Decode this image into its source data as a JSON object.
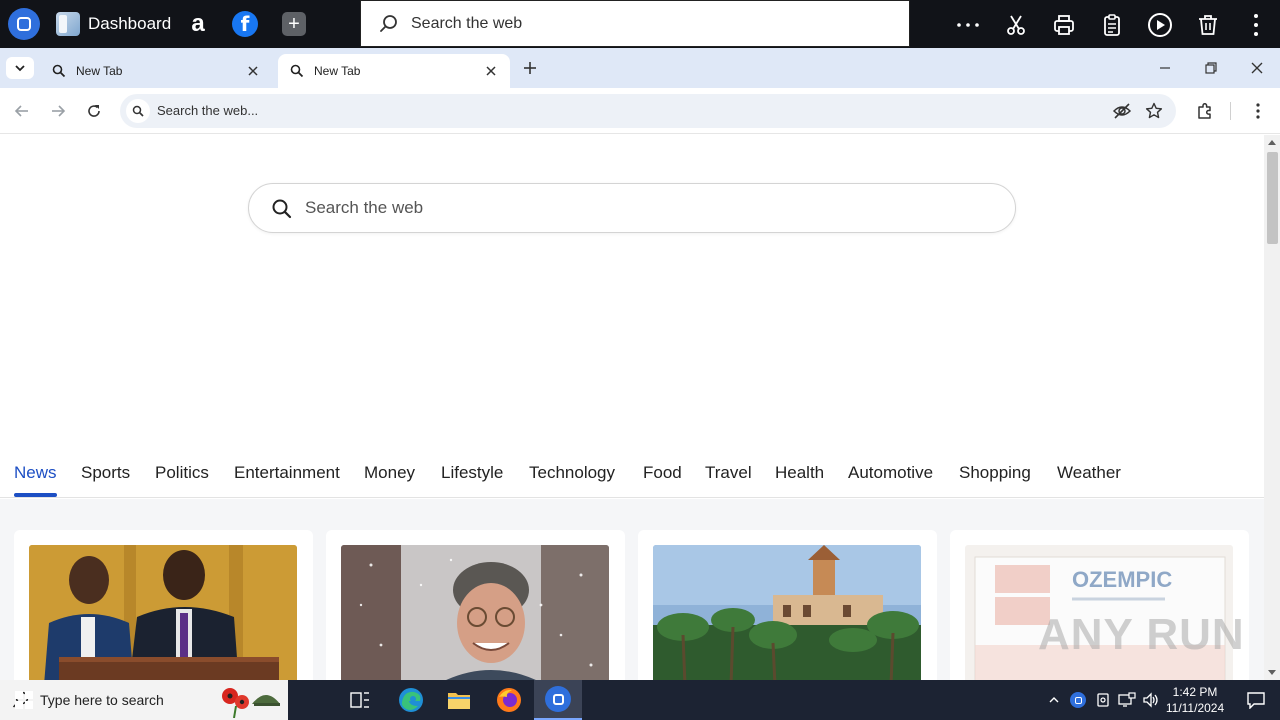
{
  "appbar": {
    "dashboard_label": "Dashboard",
    "search_placeholder": "Search the web",
    "amazon_glyph": "a",
    "facebook_glyph": "f",
    "plus_glyph": "+"
  },
  "tabs": [
    {
      "title": "New Tab",
      "active": false
    },
    {
      "title": "New Tab",
      "active": true
    }
  ],
  "toolbar": {
    "omnibox_placeholder": "Search the web..."
  },
  "page": {
    "search_placeholder": "Search the web",
    "categories": [
      "News",
      "Sports",
      "Politics",
      "Entertainment",
      "Money",
      "Lifestyle",
      "Technology",
      "Food",
      "Travel",
      "Health",
      "Automotive",
      "Shopping",
      "Weather"
    ],
    "active_category": "News",
    "cards": [
      {
        "image": "press-conference-photo"
      },
      {
        "image": "man-in-snow-photo"
      },
      {
        "image": "palm-estate-photo"
      },
      {
        "image": "ozempic-box-photo",
        "overlay_text": "OZEMPIC"
      }
    ],
    "watermark": "ANY RUN"
  },
  "taskbar": {
    "search_placeholder": "Type here to search",
    "time": "1:42 PM",
    "date": "11/11/2024"
  },
  "colors": {
    "accent": "#1d4fc4",
    "appbar_bg": "#111318",
    "tabstrip_bg": "#dfe8f7",
    "taskbar_bg": "#1c2333"
  }
}
